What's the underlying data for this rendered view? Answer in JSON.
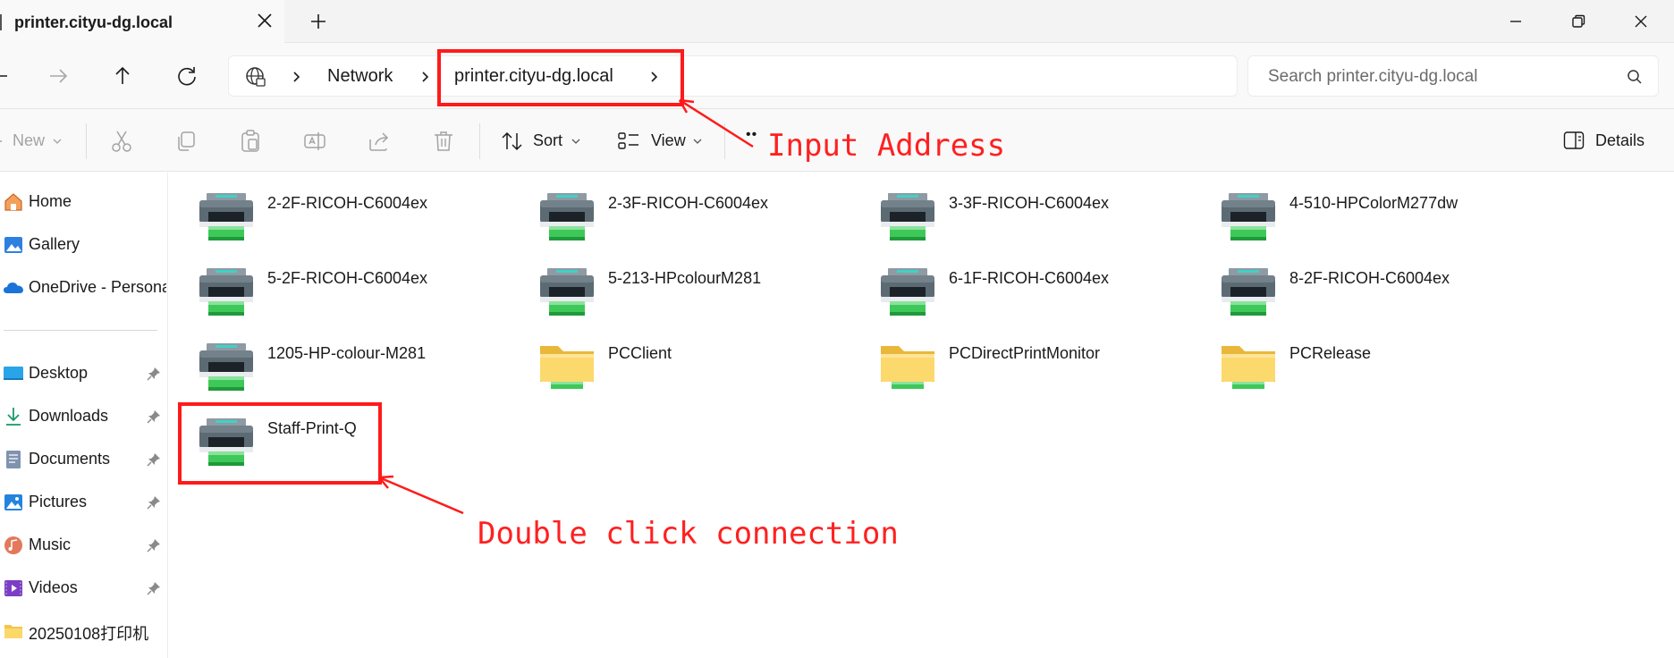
{
  "window": {
    "tab_title": "printer.cityu-dg.local"
  },
  "address_bar": {
    "crumbs": [
      "Network",
      "printer.cityu-dg.local"
    ],
    "search_placeholder": "Search printer.cityu-dg.local"
  },
  "command_bar": {
    "new_label": "New",
    "sort_label": "Sort",
    "view_label": "View",
    "more_label": "••",
    "details_label": "Details"
  },
  "sidebar": {
    "items": [
      {
        "label": "Home",
        "icon": "home-icon"
      },
      {
        "label": "Gallery",
        "icon": "gallery-icon"
      },
      {
        "label": "OneDrive - Persona",
        "icon": "onedrive-icon"
      },
      {
        "label": "Desktop",
        "icon": "desktop-icon",
        "pinned": true
      },
      {
        "label": "Downloads",
        "icon": "downloads-icon",
        "pinned": true
      },
      {
        "label": "Documents",
        "icon": "documents-icon",
        "pinned": true
      },
      {
        "label": "Pictures",
        "icon": "pictures-icon",
        "pinned": true
      },
      {
        "label": "Music",
        "icon": "music-icon",
        "pinned": true
      },
      {
        "label": "Videos",
        "icon": "videos-icon",
        "pinned": true
      },
      {
        "label": "20250108打印机",
        "icon": "folder-icon"
      }
    ]
  },
  "content": {
    "items": [
      {
        "label": "2-2F-RICOH-C6004ex",
        "type": "printer"
      },
      {
        "label": "2-3F-RICOH-C6004ex",
        "type": "printer"
      },
      {
        "label": "3-3F-RICOH-C6004ex",
        "type": "printer"
      },
      {
        "label": "4-510-HPColorM277dw",
        "type": "printer"
      },
      {
        "label": "5-2F-RICOH-C6004ex",
        "type": "printer"
      },
      {
        "label": "5-213-HPcolourM281",
        "type": "printer"
      },
      {
        "label": "6-1F-RICOH-C6004ex",
        "type": "printer"
      },
      {
        "label": "8-2F-RICOH-C6004ex",
        "type": "printer"
      },
      {
        "label": "1205-HP-colour-M281",
        "type": "printer"
      },
      {
        "label": "PCClient",
        "type": "folder"
      },
      {
        "label": "PCDirectPrintMonitor",
        "type": "folder"
      },
      {
        "label": "PCRelease",
        "type": "folder"
      },
      {
        "label": "Staff-Print-Q",
        "type": "printer"
      }
    ]
  },
  "annotations": {
    "input_address": "Input Address",
    "double_click": "Double click connection",
    "color": "#ff1a1a"
  }
}
